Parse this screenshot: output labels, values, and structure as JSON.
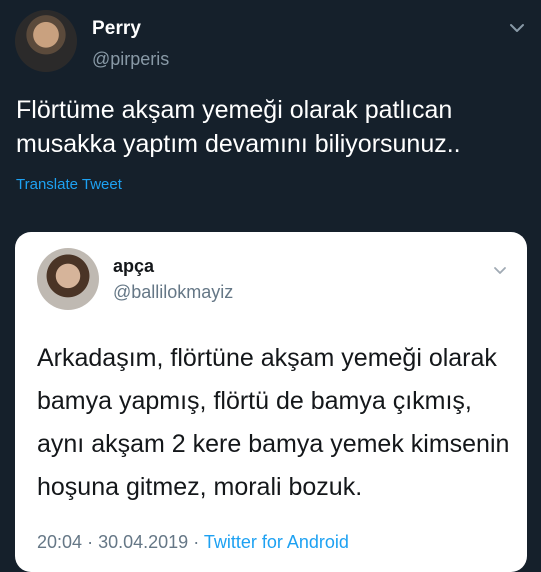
{
  "tweet": {
    "display_name": "Perry",
    "handle": "@pirperis",
    "text": "Flörtüme akşam yemeği olarak patlıcan musakka yaptım devamını biliyorsunuz..",
    "translate_label": "Translate Tweet",
    "menu_icon": "chevron-down-icon"
  },
  "quoted_tweet": {
    "display_name": "apça",
    "handle": "@ballilokmayiz",
    "text": "Arkadaşım, flörtüne akşam yemeği olarak bamya yapmış, flörtü de bamya çıkmış, aynı akşam 2 kere bamya yemek kimsenin hoşuna gitmez, morali bozuk.",
    "time": "20:04",
    "separator": "·",
    "date": "30.04.2019",
    "source": "Twitter for Android",
    "menu_icon": "chevron-down-icon"
  },
  "colors": {
    "background": "#15202b",
    "accent": "#1da1f2",
    "secondary_text": "#8899a6"
  }
}
